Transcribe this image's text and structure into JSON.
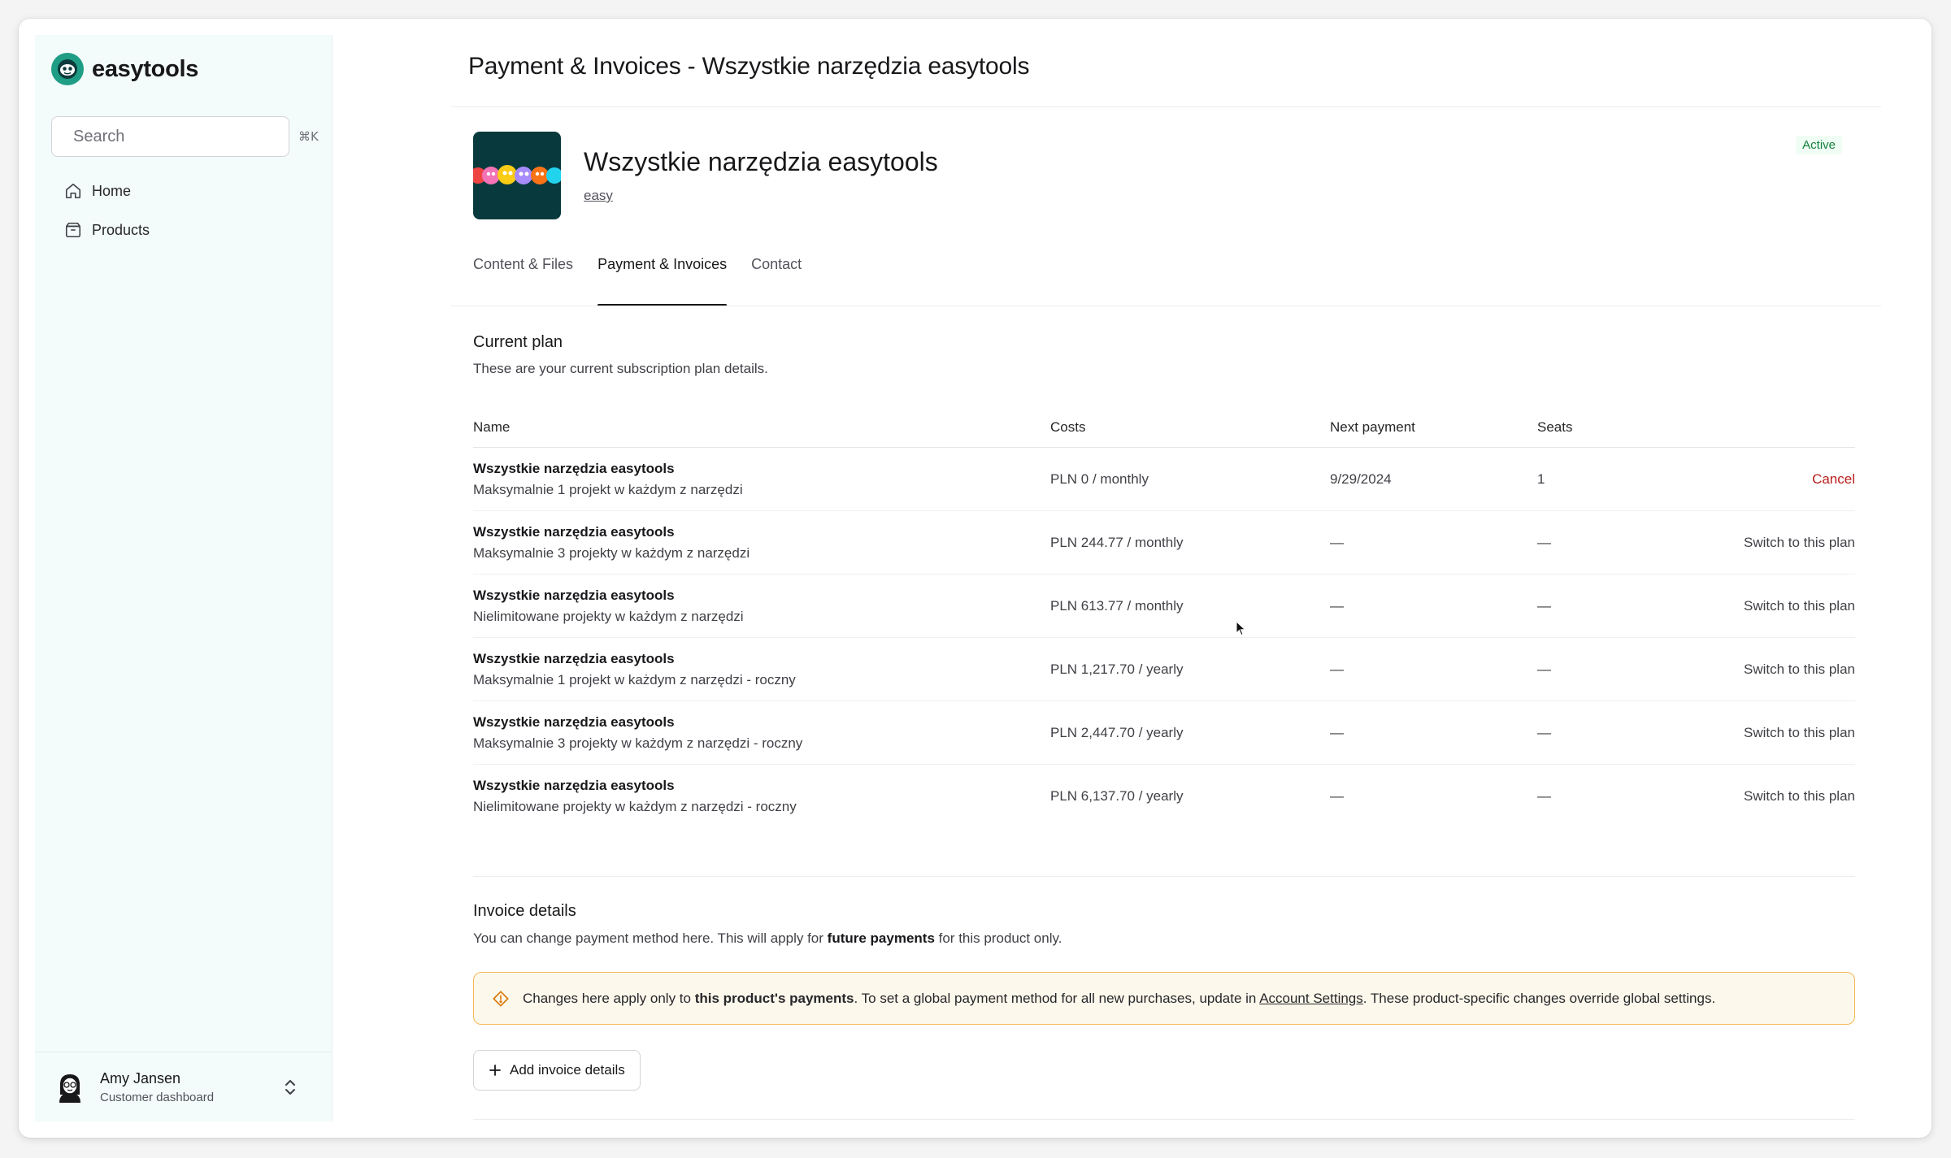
{
  "app": {
    "brand": "easytools"
  },
  "sidebar": {
    "search": {
      "placeholder": "Search",
      "shortcut": "⌘K"
    },
    "items": [
      {
        "label": "Home",
        "icon": "home-icon"
      },
      {
        "label": "Products",
        "icon": "box-icon"
      }
    ],
    "user": {
      "name": "Amy Jansen",
      "role": "Customer dashboard"
    }
  },
  "page": {
    "title": "Payment & Invoices - Wszystkie narzędzia easytools"
  },
  "product": {
    "name": "Wszystkie narzędzia easytools",
    "link": "easy",
    "status": "Active"
  },
  "tabs": [
    {
      "label": "Content & Files",
      "active": false
    },
    {
      "label": "Payment & Invoices",
      "active": true
    },
    {
      "label": "Contact",
      "active": false
    }
  ],
  "current_plan": {
    "title": "Current plan",
    "description": "These are your current subscription plan details.",
    "columns": [
      "Name",
      "Costs",
      "Next payment",
      "Seats"
    ],
    "rows": [
      {
        "name": "Wszystkie narzędzia easytools",
        "sub": "Maksymalnie 1 projekt w każdym z narzędzi",
        "cost": "PLN 0 / monthly",
        "next": "9/29/2024",
        "seats": "1",
        "action": "Cancel"
      },
      {
        "name": "Wszystkie narzędzia easytools",
        "sub": "Maksymalnie 3 projekty w każdym z narzędzi",
        "cost": "PLN 244.77 / monthly",
        "next": "—",
        "seats": "—",
        "action": "Switch to this plan"
      },
      {
        "name": "Wszystkie narzędzia easytools",
        "sub": "Nielimitowane projekty w każdym z narzędzi",
        "cost": "PLN 613.77 / monthly",
        "next": "—",
        "seats": "—",
        "action": "Switch to this plan"
      },
      {
        "name": "Wszystkie narzędzia easytools",
        "sub": "Maksymalnie 1 projekt w każdym z narzędzi - roczny",
        "cost": "PLN 1,217.70 / yearly",
        "next": "—",
        "seats": "—",
        "action": "Switch to this plan"
      },
      {
        "name": "Wszystkie narzędzia easytools",
        "sub": "Maksymalnie 3 projekty w każdym z narzędzi - roczny",
        "cost": "PLN 2,447.70 / yearly",
        "next": "—",
        "seats": "—",
        "action": "Switch to this plan"
      },
      {
        "name": "Wszystkie narzędzia easytools",
        "sub": "Nielimitowane projekty w każdym z narzędzi - roczny",
        "cost": "PLN 6,137.70 / yearly",
        "next": "—",
        "seats": "—",
        "action": "Switch to this plan"
      }
    ]
  },
  "invoice": {
    "title": "Invoice details",
    "desc_pre": "You can change payment method here. This will apply for ",
    "desc_bold": "future payments",
    "desc_post": " for this product only.",
    "notice": {
      "pre": "Changes here apply only to ",
      "bold": "this product's payments",
      "mid": ". To set a global payment method for all new purchases, update in ",
      "link": "Account Settings",
      "post": ". These product-specific changes override global settings."
    },
    "add_button": "Add invoice details"
  },
  "colors": {
    "accent": "#1f9d85",
    "active": "#15803d",
    "cancel": "#b91c1c",
    "warning_border": "#f4b859"
  }
}
